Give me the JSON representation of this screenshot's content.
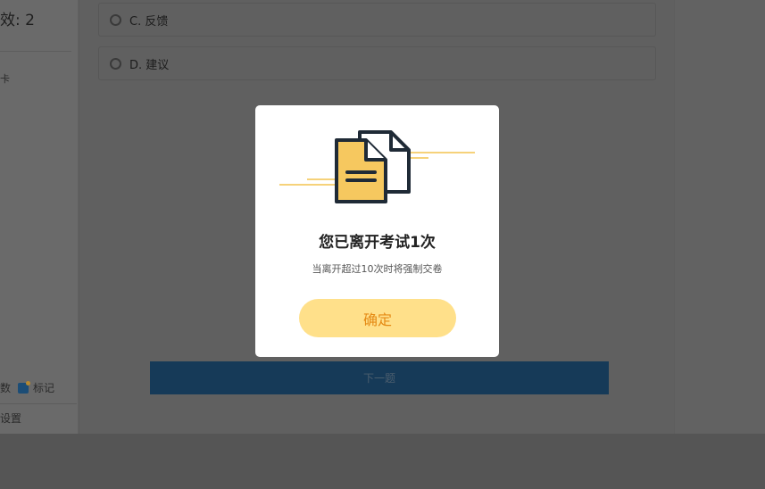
{
  "left_panel": {
    "count_text": "效: 2",
    "small_label": "卡",
    "legend_left": "数",
    "legend_mark": "标记",
    "settings": "设置"
  },
  "options": [
    {
      "label": "C. 反馈"
    },
    {
      "label": "D. 建议"
    }
  ],
  "next_button": "下一题",
  "modal": {
    "title": "您已离开考试1次",
    "subtitle": "当离开超过10次时将强制交卷",
    "confirm": "确定",
    "illustration_icon": "document-files-icon",
    "accent_color": "#ffe08a",
    "accent_text_color": "#e58a14"
  }
}
